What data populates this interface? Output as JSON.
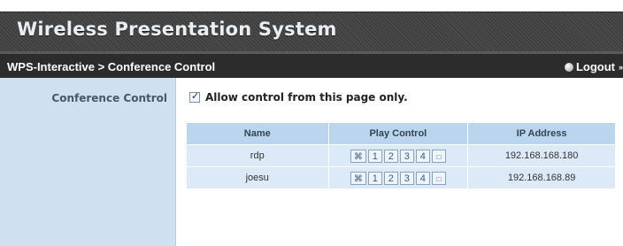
{
  "header": {
    "title": "Wireless Presentation System",
    "breadcrumb": "WPS-Interactive > Conference Control",
    "logout_label": "Logout",
    "logout_suffix": "»"
  },
  "sidebar": {
    "label": "Conference Control"
  },
  "allow_control": {
    "label": "Allow control from this page only.",
    "checked": true
  },
  "table": {
    "headers": [
      "Name",
      "Play Control",
      "IP Address"
    ],
    "rows": [
      {
        "name": "rdp",
        "ip": "192.168.168.180"
      },
      {
        "name": "joesu",
        "ip": "192.168.168.89"
      }
    ],
    "controls": {
      "fullscreen": "⌘",
      "split1": "1",
      "split2": "2",
      "split3": "3",
      "split4": "4",
      "stop": "□"
    }
  },
  "icons": {
    "logout": "logout-icon",
    "fullscreen": "fullscreen-icon",
    "stop": "stop-icon"
  }
}
